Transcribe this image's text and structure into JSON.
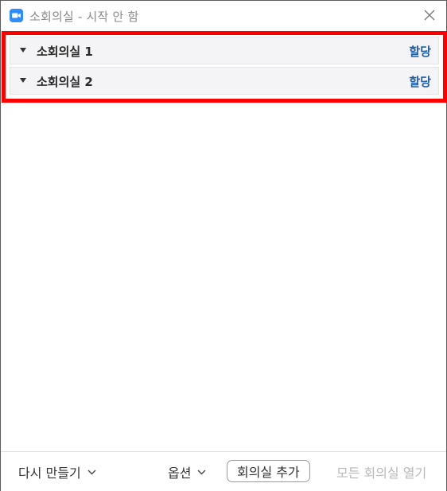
{
  "window": {
    "title": "소회의실 - 시작 안 함",
    "app_icon": "zoom-camera-icon",
    "close_icon": "close-icon"
  },
  "rooms": [
    {
      "name": "소회의실 1",
      "assign_label": "할당"
    },
    {
      "name": "소회의실 2",
      "assign_label": "할당"
    }
  ],
  "footer": {
    "recreate_label": "다시 만들기",
    "options_label": "옵션",
    "add_room_label": "회의실 추가",
    "open_all_label": "모든 회의실 열기"
  },
  "colors": {
    "highlight_border": "#ff0000",
    "link": "#1f5fa8",
    "app_icon": "#2d8cff",
    "disabled_text": "#b8b8b8"
  }
}
